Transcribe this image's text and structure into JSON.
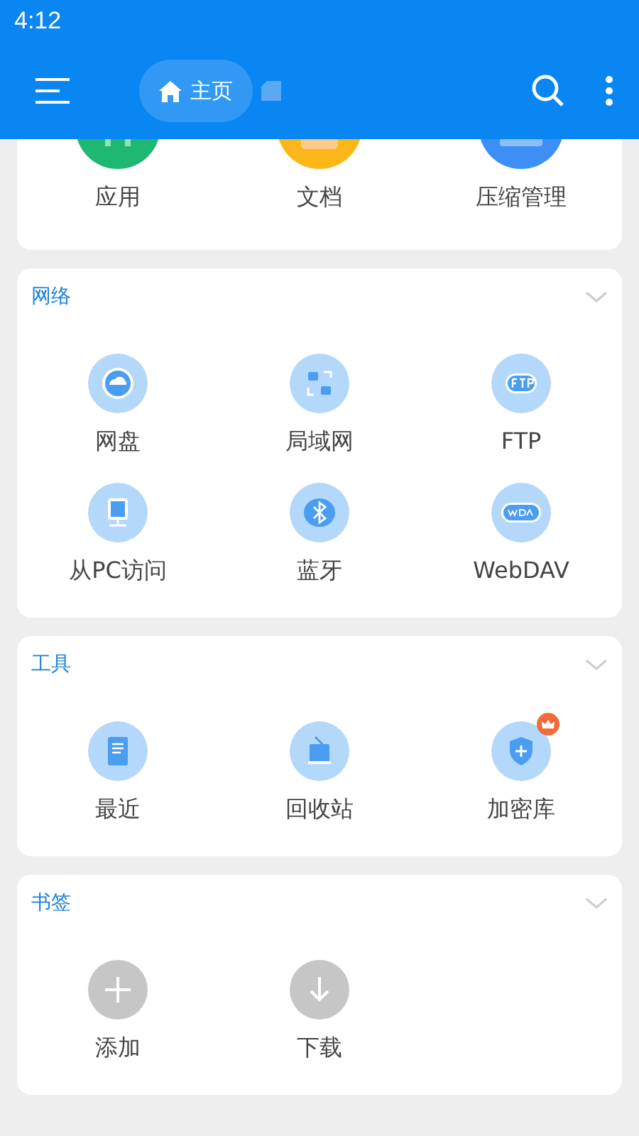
{
  "status_bar": {
    "time": "4:12"
  },
  "app_bar": {
    "breadcrumb": [
      {
        "label": "主页",
        "selected": true
      }
    ]
  },
  "top_card": {
    "items": [
      {
        "label": "应用"
      },
      {
        "label": "文档"
      },
      {
        "label": "压缩管理"
      }
    ]
  },
  "sections": [
    {
      "title": "网络",
      "items": [
        {
          "label": "网盘"
        },
        {
          "label": "局域网"
        },
        {
          "label": "FTP"
        },
        {
          "label": "从PC访问"
        },
        {
          "label": "蓝牙"
        },
        {
          "label": "WebDAV"
        }
      ]
    },
    {
      "title": "工具",
      "items": [
        {
          "label": "最近"
        },
        {
          "label": "回收站"
        },
        {
          "label": "加密库"
        }
      ]
    },
    {
      "title": "书签",
      "items": [
        {
          "label": "添加"
        },
        {
          "label": "下载"
        }
      ]
    }
  ]
}
